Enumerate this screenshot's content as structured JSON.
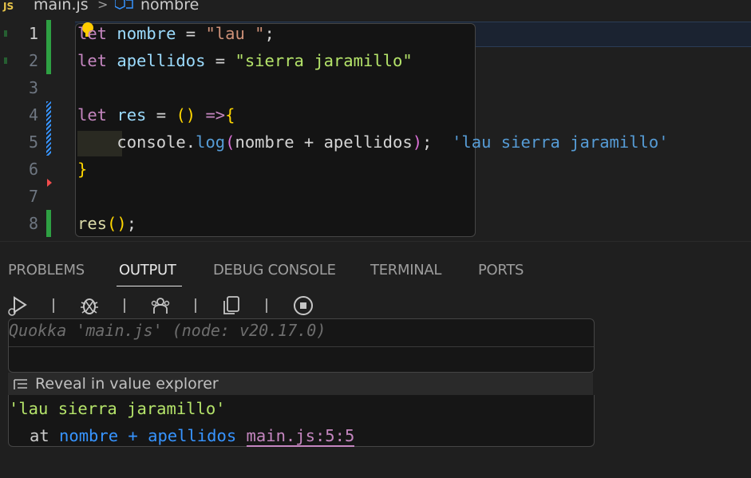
{
  "breadcrumb": {
    "file_badge": "JS",
    "file": "main.js",
    "separator": ">",
    "symbol": "nombre"
  },
  "editor": {
    "line_numbers": [
      "1",
      "2",
      "3",
      "4",
      "5",
      "6",
      "7",
      "8"
    ],
    "lines": {
      "l1": {
        "kw": "let",
        "sp1": " ",
        "var": "nombre",
        "op": " = ",
        "str": "\"lau \"",
        "end": ";"
      },
      "l2": {
        "kw": "let",
        "sp1": " ",
        "var": "apellidos",
        "op": " = ",
        "str": "\"sierra jaramillo\""
      },
      "l4": {
        "kw": "let",
        "sp1": " ",
        "var": "res",
        "op": " = ",
        "paren": "()",
        "arrow": " =>",
        "brace": "{"
      },
      "l5": {
        "indent": "    ",
        "obj": "console",
        "dot": ".",
        "fn": "log",
        "p1": "(",
        "a": "nombre",
        "plus": " + ",
        "b": "apellidos",
        "p2": ")",
        "end": ";",
        "inline_value": "'lau sierra jaramillo'"
      },
      "l6": {
        "brace": "}"
      },
      "l8": {
        "fn": "res",
        "paren": "()",
        "end": ";"
      }
    }
  },
  "panel": {
    "tabs": [
      "PROBLEMS",
      "OUTPUT",
      "DEBUG CONSOLE",
      "TERMINAL",
      "PORTS"
    ],
    "active_tab": "OUTPUT",
    "quokka_header": "Quokka 'main.js' (node: v20.17.0)",
    "reveal_label": "Reveal in value explorer",
    "result_value": "'lau sierra jaramillo'",
    "trace_at": "at ",
    "trace_expr": "nombre + apellidos",
    "trace_location": "main.js:5:5"
  },
  "colors": {
    "keyword": "#c586c0",
    "variable": "#9cdcfe",
    "string_light": "#ce9178",
    "string_green": "#b5e46a",
    "inline_value": "#569cd6",
    "gutter_modified": "#2ea043"
  },
  "icons": [
    "js-file-icon",
    "symbol-variable-icon",
    "lightbulb-icon",
    "run-debug-icon",
    "debug-icon",
    "people-icon",
    "copy-icon",
    "stop-icon",
    "list-icon"
  ]
}
